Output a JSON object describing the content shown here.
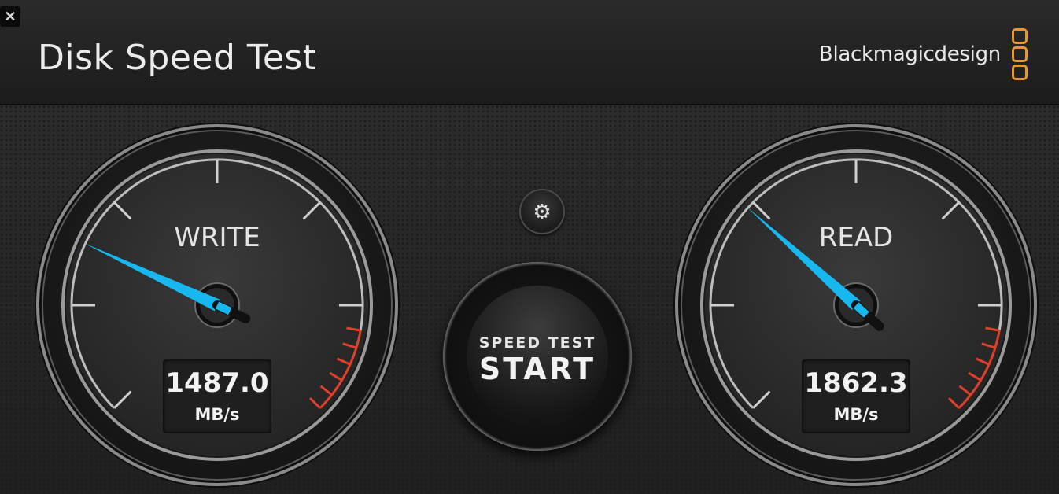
{
  "window": {
    "close_glyph": "✕",
    "title": "Disk Speed Test"
  },
  "brand": {
    "name": "Blackmagicdesign",
    "logo_icon": "three-rounded-squares-logo",
    "accent_color": "#e8962e"
  },
  "settings": {
    "icon": "gear-icon",
    "glyph": "⚙"
  },
  "start_button": {
    "line1": "SPEED TEST",
    "line2": "START"
  },
  "gauges": {
    "write": {
      "label": "WRITE",
      "value": "1487.0",
      "unit": "MB/s",
      "needle_color": "#17b7ef"
    },
    "read": {
      "label": "READ",
      "value": "1862.3",
      "unit": "MB/s",
      "needle_color": "#17b7ef"
    }
  },
  "colors": {
    "redline": "#e0402a",
    "needle": "#17b7ef"
  }
}
